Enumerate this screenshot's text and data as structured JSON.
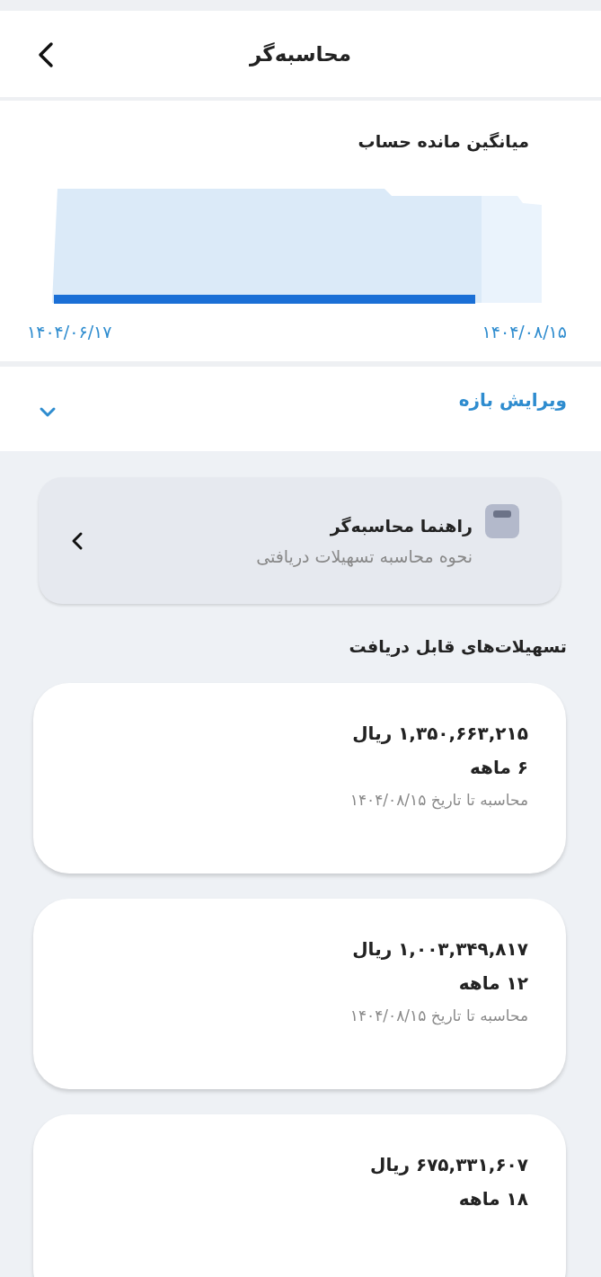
{
  "header": {
    "title": "محاسبه‌گر"
  },
  "balance_chart": {
    "title": "میانگین مانده حساب",
    "start_date": "۱۴۰۴/۰۸/۱۵",
    "end_date": "۱۴۰۴/۰۶/۱۷"
  },
  "range_editor": {
    "label": "ویرایش بازه",
    "expanded": false
  },
  "guide": {
    "title": "راهنما محاسبه‌گر",
    "subtitle": "نحوه محاسبه تسهیلات دریافتی"
  },
  "loans_heading": "تسهیلات‌های قابل دریافت",
  "loans": [
    {
      "amount": "۱,۳۵۰,۶۶۳,۲۱۵ ریال",
      "term": "۶ ماهه",
      "calc_date": "محاسبه تا تاریخ ۱۴۰۴/۰۸/۱۵"
    },
    {
      "amount": "۱,۰۰۳,۳۴۹,۸۱۷ ریال",
      "term": "۱۲ ماهه",
      "calc_date": "محاسبه تا تاریخ ۱۴۰۴/۰۸/۱۵"
    },
    {
      "amount": "۶۷۵,۳۳۱,۶۰۷ ریال",
      "term": "۱۸ ماهه"
    }
  ]
}
